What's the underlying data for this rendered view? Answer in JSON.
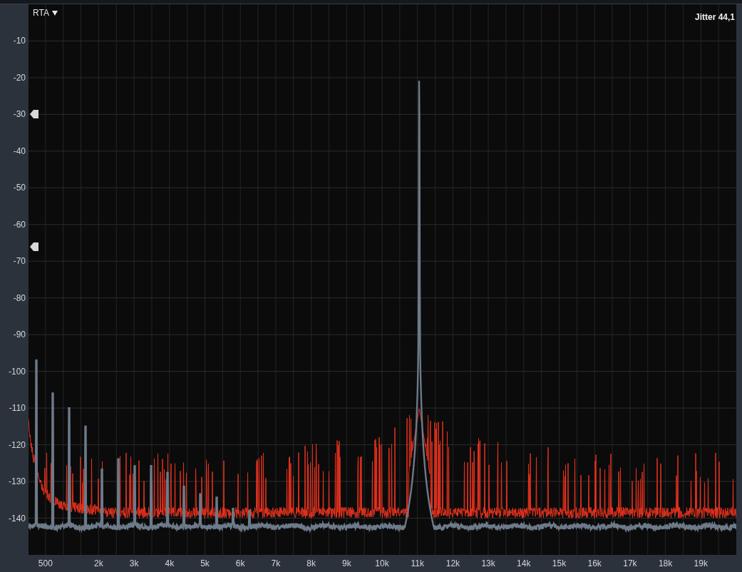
{
  "analyzer": {
    "mode_menu": {
      "label": "RTA"
    },
    "title": "Jitter 44,1",
    "y_axis_labels": [
      "-10",
      "-20",
      "-30",
      "-40",
      "-50",
      "-60",
      "-70",
      "-80",
      "-90",
      "-100",
      "-110",
      "-120",
      "-130",
      "-140"
    ],
    "x_axis_labels": [
      "500",
      "2k",
      "3k",
      "4k",
      "5k",
      "6k",
      "7k",
      "8k",
      "9k",
      "10k",
      "11k",
      "12k",
      "13k",
      "14k",
      "15k",
      "16k",
      "17k",
      "18k",
      "19k"
    ],
    "traces": [
      {
        "color": "#e8321e"
      },
      {
        "color": "#6d7a8a"
      }
    ]
  }
}
